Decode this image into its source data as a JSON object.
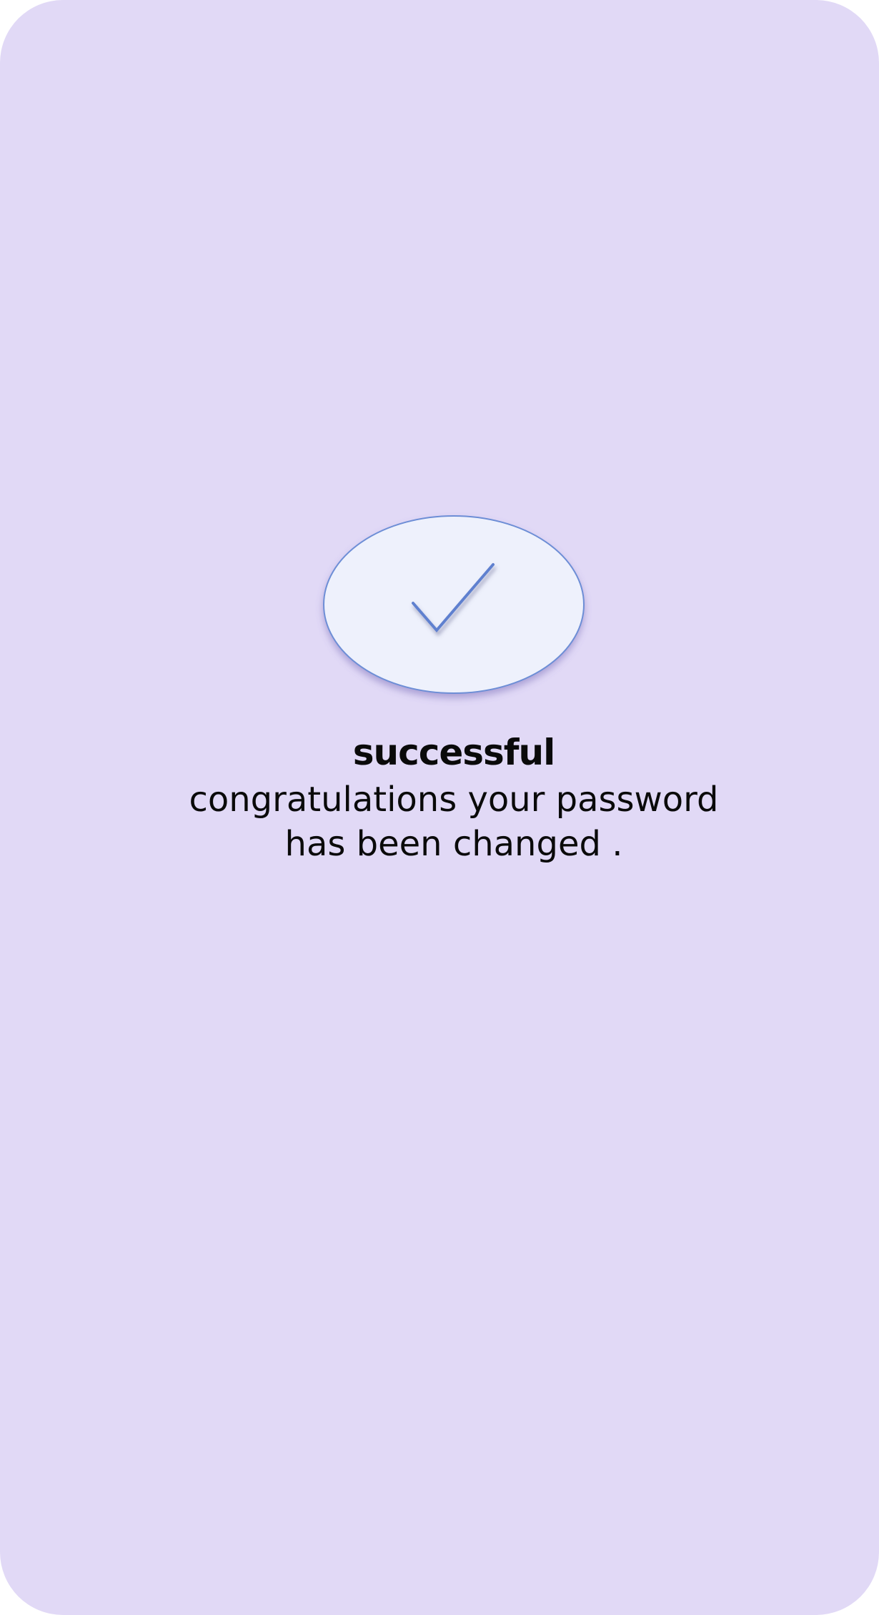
{
  "screen": {
    "background_color": "#e1d9f6"
  },
  "success_badge": {
    "icon": "checkmark-icon",
    "fill_color": "#eef1fc",
    "stroke_color": "#6d8ed6"
  },
  "message": {
    "title": "successful",
    "line1": "congratulations your password",
    "line2": "has been changed ."
  }
}
